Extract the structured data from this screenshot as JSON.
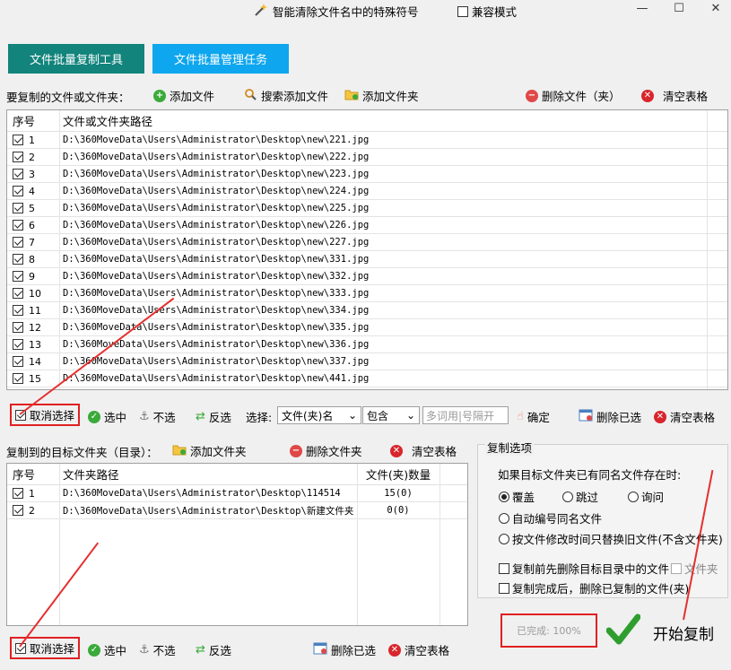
{
  "window": {
    "title": "智能清除文件名中的特殊符号",
    "compat_label": "兼容模式",
    "min": "—",
    "max": "☐",
    "close": "✕"
  },
  "tabs": [
    {
      "label": "文件批量复制工具"
    },
    {
      "label": "文件批量管理任务"
    }
  ],
  "source": {
    "label": "要复制的文件或文件夹：",
    "add_file": "添加文件",
    "search_add": "搜索添加文件",
    "add_folder": "添加文件夹",
    "delete": "删除文件（夹）",
    "clear": "清空表格",
    "col_index": "序号",
    "col_path": "文件或文件夹路径",
    "rows": [
      {
        "n": "1",
        "path": "D:\\360MoveData\\Users\\Administrator\\Desktop\\new\\221.jpg"
      },
      {
        "n": "2",
        "path": "D:\\360MoveData\\Users\\Administrator\\Desktop\\new\\222.jpg"
      },
      {
        "n": "3",
        "path": "D:\\360MoveData\\Users\\Administrator\\Desktop\\new\\223.jpg"
      },
      {
        "n": "4",
        "path": "D:\\360MoveData\\Users\\Administrator\\Desktop\\new\\224.jpg"
      },
      {
        "n": "5",
        "path": "D:\\360MoveData\\Users\\Administrator\\Desktop\\new\\225.jpg"
      },
      {
        "n": "6",
        "path": "D:\\360MoveData\\Users\\Administrator\\Desktop\\new\\226.jpg"
      },
      {
        "n": "7",
        "path": "D:\\360MoveData\\Users\\Administrator\\Desktop\\new\\227.jpg"
      },
      {
        "n": "8",
        "path": "D:\\360MoveData\\Users\\Administrator\\Desktop\\new\\331.jpg"
      },
      {
        "n": "9",
        "path": "D:\\360MoveData\\Users\\Administrator\\Desktop\\new\\332.jpg"
      },
      {
        "n": "10",
        "path": "D:\\360MoveData\\Users\\Administrator\\Desktop\\new\\333.jpg"
      },
      {
        "n": "11",
        "path": "D:\\360MoveData\\Users\\Administrator\\Desktop\\new\\334.jpg"
      },
      {
        "n": "12",
        "path": "D:\\360MoveData\\Users\\Administrator\\Desktop\\new\\335.jpg"
      },
      {
        "n": "13",
        "path": "D:\\360MoveData\\Users\\Administrator\\Desktop\\new\\336.jpg"
      },
      {
        "n": "14",
        "path": "D:\\360MoveData\\Users\\Administrator\\Desktop\\new\\337.jpg"
      },
      {
        "n": "15",
        "path": "D:\\360MoveData\\Users\\Administrator\\Desktop\\new\\441.jpg"
      }
    ],
    "uncheck": "取消选择",
    "select": "选中",
    "deselect": "不选",
    "invert": "反选",
    "choose_label": "选择:",
    "type_value": "文件(夹)名",
    "match_value": "包含",
    "keyword_placeholder": "多词用|号隔开",
    "confirm": "确定",
    "delete_selected": "删除已选",
    "clear_table": "清空表格"
  },
  "target": {
    "label": "复制到的目标文件夹（目录）：",
    "add_folder": "添加文件夹",
    "delete_folder": "删除文件夹",
    "clear": "清空表格",
    "col_index": "序号",
    "col_path": "文件夹路径",
    "col_count": "文件(夹)数量",
    "rows": [
      {
        "n": "1",
        "path": "D:\\360MoveData\\Users\\Administrator\\Desktop\\114514",
        "count": "15(0)"
      },
      {
        "n": "2",
        "path": "D:\\360MoveData\\Users\\Administrator\\Desktop\\新建文件夹",
        "count": "0(0)"
      }
    ],
    "uncheck": "取消选择",
    "select": "选中",
    "deselect": "不选",
    "invert": "反选",
    "delete_selected": "删除已选",
    "clear_table": "清空表格"
  },
  "options": {
    "title": "复制选项",
    "question": "如果目标文件夹已有同名文件存在时:",
    "overwrite": "覆盖",
    "skip": "跳过",
    "ask": "询问",
    "auto_number": "自动编号同名文件",
    "by_time": "按文件修改时间只替换旧文件(不含文件夹)",
    "delete_before": "复制前先删除目标目录中的文件",
    "folder_sub": "文件夹",
    "delete_after": "复制完成后，删除已复制的文件(夹)"
  },
  "status": {
    "progress_text": "已完成: 100%",
    "progress": 1.0,
    "start": "开始复制"
  }
}
